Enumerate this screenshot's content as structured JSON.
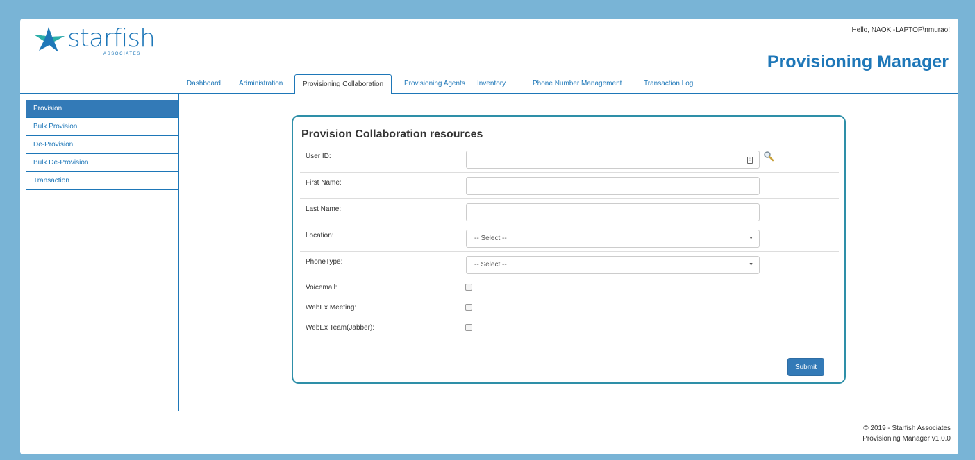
{
  "header": {
    "logo_text": "starfish",
    "logo_subtext": "ASSOCIATES",
    "greeting": "Hello, NAOKI-LAPTOP\\nmurao!",
    "app_title": "Provisioning Manager"
  },
  "tabs": [
    {
      "label": "Dashboard",
      "active": false
    },
    {
      "label": "Administration",
      "active": false
    },
    {
      "label": "Provisioning Collaboration",
      "active": true
    },
    {
      "label": "Provisioning Agents",
      "active": false
    },
    {
      "label": "Inventory",
      "active": false
    },
    {
      "label": "Phone Number Management",
      "active": false
    },
    {
      "label": "Transaction Log",
      "active": false
    }
  ],
  "sidebar": {
    "items": [
      {
        "label": "Provision",
        "active": true
      },
      {
        "label": "Bulk Provision",
        "active": false
      },
      {
        "label": "De-Provision",
        "active": false
      },
      {
        "label": "Bulk De-Provision",
        "active": false
      },
      {
        "label": "Transaction",
        "active": false
      }
    ]
  },
  "form": {
    "title": "Provision Collaboration resources",
    "user_id": {
      "label": "User ID:",
      "value": ""
    },
    "first_name": {
      "label": "First Name:",
      "value": ""
    },
    "last_name": {
      "label": "Last Name:",
      "value": ""
    },
    "location": {
      "label": "Location:",
      "selected": "-- Select --"
    },
    "phone_type": {
      "label": "PhoneType:",
      "selected": "-- Select --"
    },
    "voicemail": {
      "label": "Voicemail:",
      "checked": false
    },
    "webex_meeting": {
      "label": "WebEx Meeting:",
      "checked": false
    },
    "webex_team": {
      "label": "WebEx Team(Jabber):",
      "checked": false
    },
    "submit_label": "Submit"
  },
  "footer": {
    "copyright": "© 2019 - Starfish Associates",
    "version": "Provisioning Manager v1.0.0"
  },
  "colors": {
    "brand": "#1e77b8",
    "active_bg": "#337ab7",
    "card_border": "#2e8fa8",
    "page_bg": "#79b4d6"
  }
}
